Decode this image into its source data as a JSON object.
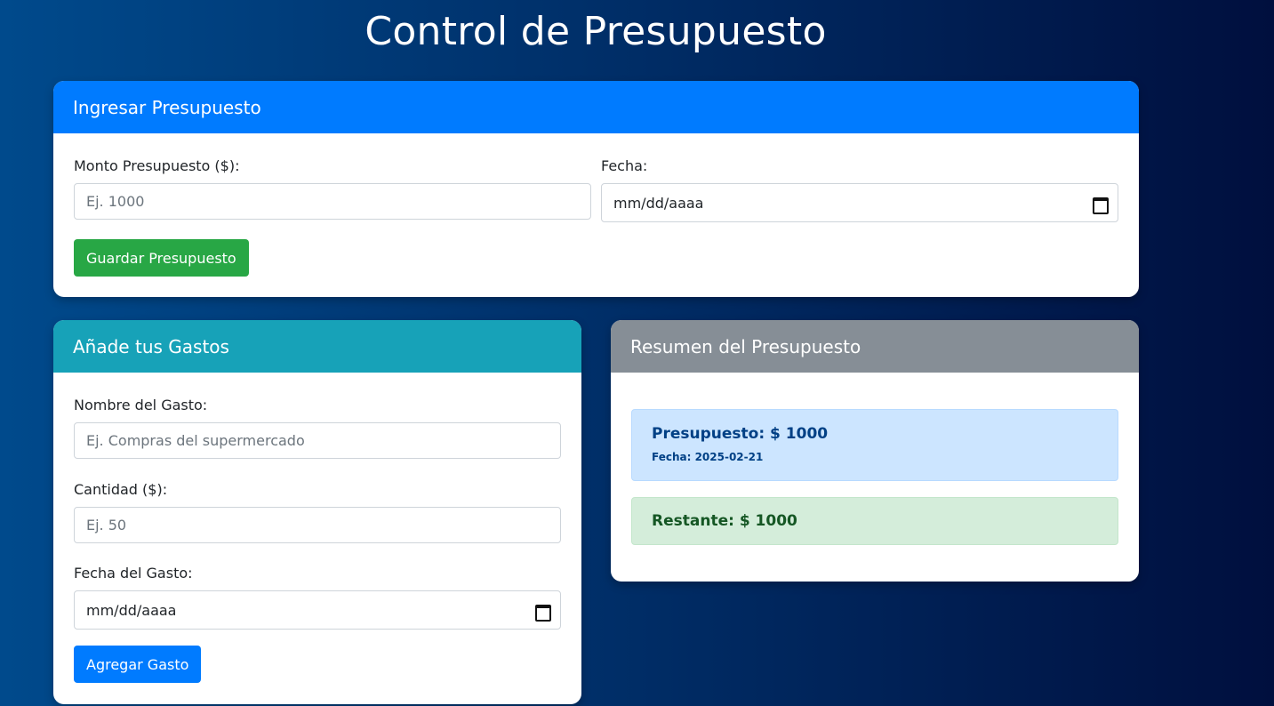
{
  "page": {
    "title": "Control de Presupuesto"
  },
  "budget_card": {
    "header": "Ingresar Presupuesto",
    "header_color": "#007bff",
    "amount_label": "Monto Presupuesto ($):",
    "amount_placeholder": "Ej. 1000",
    "date_label": "Fecha:",
    "date_value": "mm/dd/aaaa",
    "save_button": "Guardar Presupuesto",
    "save_button_color": "#28a745"
  },
  "expenses_card": {
    "header": "Añade tus Gastos",
    "header_color": "#17a2b8",
    "name_label": "Nombre del Gasto:",
    "name_placeholder": "Ej. Compras del supermercado",
    "amount_label": "Cantidad ($):",
    "amount_placeholder": "Ej. 50",
    "date_label": "Fecha del Gasto:",
    "date_value": "mm/dd/aaaa",
    "add_button": "Agregar Gasto",
    "add_button_color": "#007bff"
  },
  "summary_card": {
    "header": "Resumen del Presupuesto",
    "header_color": "#868e96",
    "budget_text": "Presupuesto: $ 1000",
    "budget_date": "Fecha: 2025-02-21",
    "remaining_text": "Restante: $ 1000"
  }
}
